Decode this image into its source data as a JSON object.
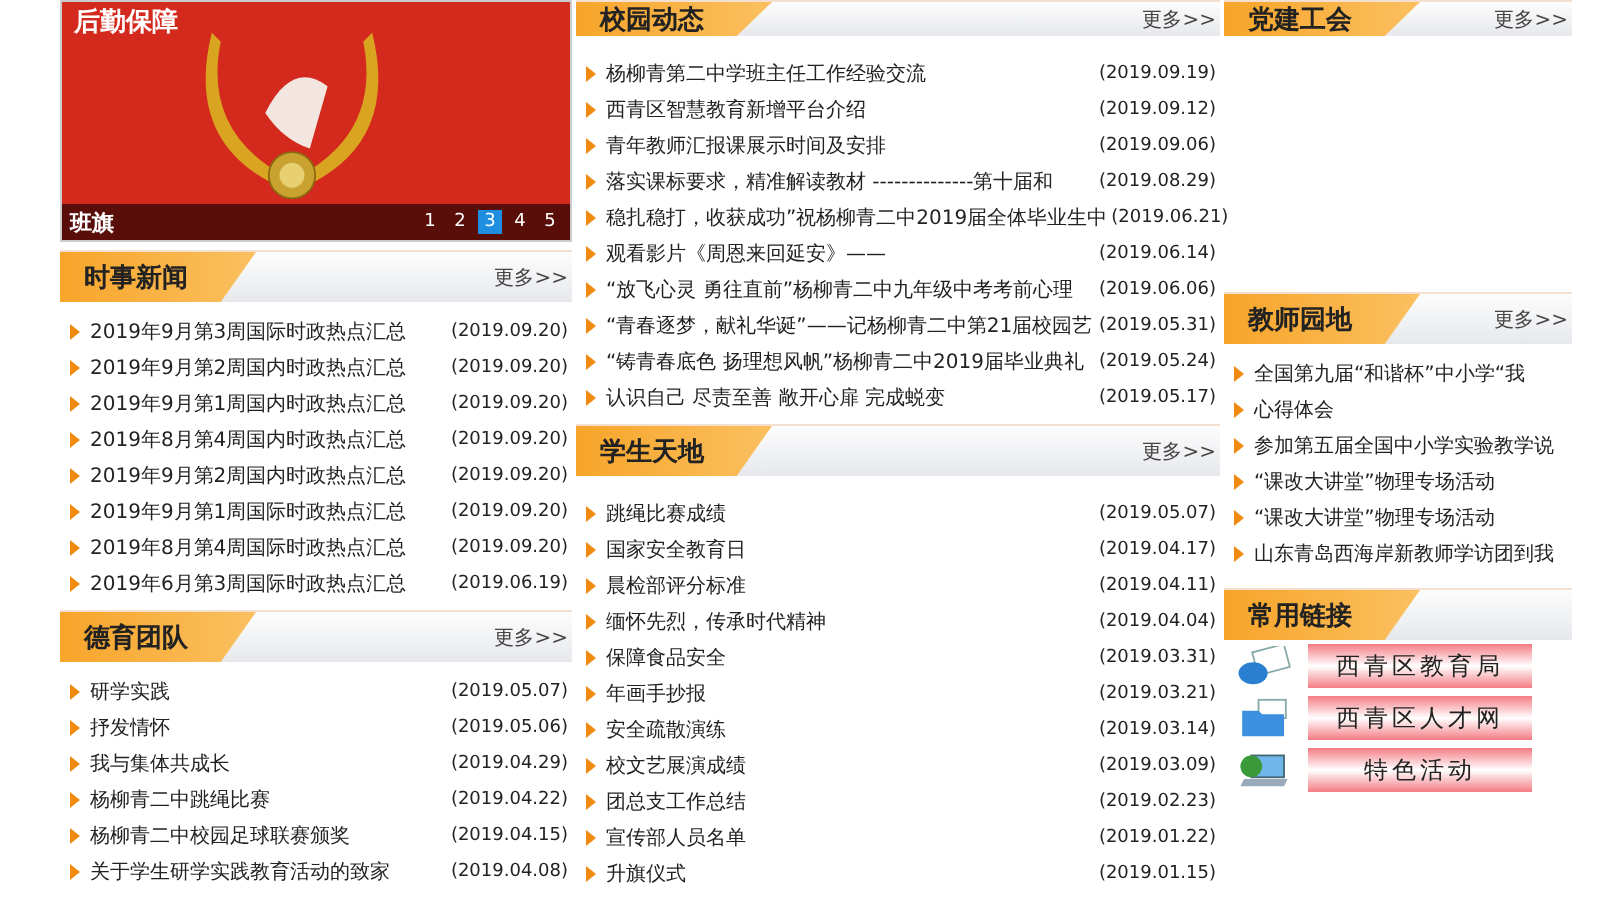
{
  "columns": [
    {
      "sections": [
        {
          "kind": "banner",
          "overlay_title": "后勤保障",
          "caption": "班旗",
          "pages": [
            {
              "label": "1",
              "selected": false
            },
            {
              "label": "2",
              "selected": false
            },
            {
              "label": "3",
              "selected": true
            },
            {
              "label": "4",
              "selected": false
            },
            {
              "label": "5",
              "selected": false
            }
          ]
        },
        {
          "kind": "list",
          "title": "时事新闻",
          "more": "更多>>",
          "items": [
            {
              "title": "2019年9月第3周国际时政热点汇总",
              "date": "(2019.09.20)"
            },
            {
              "title": "2019年9月第2周国内时政热点汇总",
              "date": "(2019.09.20)"
            },
            {
              "title": "2019年9月第1周国内时政热点汇总",
              "date": "(2019.09.20)"
            },
            {
              "title": "2019年8月第4周国内时政热点汇总",
              "date": "(2019.09.20)"
            },
            {
              "title": "2019年9月第2周国内时政热点汇总",
              "date": "(2019.09.20)"
            },
            {
              "title": "2019年9月第1周国际时政热点汇总",
              "date": "(2019.09.20)"
            },
            {
              "title": "2019年8月第4周国际时政热点汇总",
              "date": "(2019.09.20)"
            },
            {
              "title": "2019年6月第3周国际时政热点汇总",
              "date": "(2019.06.19)"
            }
          ]
        },
        {
          "kind": "list",
          "title": "德育团队",
          "more": "更多>>",
          "items": [
            {
              "title": "研学实践",
              "date": "(2019.05.07)"
            },
            {
              "title": "抒发情怀",
              "date": "(2019.05.06)"
            },
            {
              "title": "我与集体共成长",
              "date": "(2019.04.29)"
            },
            {
              "title": "杨柳青二中跳绳比赛",
              "date": "(2019.04.22)"
            },
            {
              "title": "杨柳青二中校园足球联赛颁奖",
              "date": "(2019.04.15)"
            },
            {
              "title": "关于学生研学实践教育活动的致家",
              "date": "(2019.04.08)"
            }
          ]
        }
      ]
    },
    {
      "sections": [
        {
          "kind": "list",
          "title": "校园动态",
          "more": "更多>>",
          "items": [
            {
              "title": "杨柳青第二中学班主任工作经验交流",
              "date": "(2019.09.19)"
            },
            {
              "title": "西青区智慧教育新增平台介绍",
              "date": "(2019.09.12)"
            },
            {
              "title": "青年教师汇报课展示时间及安排",
              "date": "(2019.09.06)"
            },
            {
              "title": "落实课标要求，精准解读教材 --------------第十届和",
              "date": "(2019.08.29)"
            },
            {
              "title": "稳扎稳打，收获成功”祝杨柳青二中2019届全体毕业生中",
              "date": "(2019.06.21)"
            },
            {
              "title": "观看影片《周恩来回延安》——",
              "date": "(2019.06.14)"
            },
            {
              "title": "“放飞心灵 勇往直前”杨柳青二中九年级中考考前心理",
              "date": "(2019.06.06)"
            },
            {
              "title": "“青春逐梦，献礼华诞”——记杨柳青二中第21届校园艺",
              "date": "(2019.05.31)"
            },
            {
              "title": "“铸青春底色 扬理想风帆”杨柳青二中2019届毕业典礼",
              "date": "(2019.05.24)"
            },
            {
              "title": "认识自己 尽责至善 敞开心扉 完成蜕变",
              "date": "(2019.05.17)"
            }
          ]
        },
        {
          "kind": "list",
          "title": "学生天地",
          "more": "更多>>",
          "items": [
            {
              "title": "跳绳比赛成绩",
              "date": "(2019.05.07)"
            },
            {
              "title": "国家安全教育日",
              "date": "(2019.04.17)"
            },
            {
              "title": "晨检部评分标准",
              "date": "(2019.04.11)"
            },
            {
              "title": "缅怀先烈，传承时代精神",
              "date": "(2019.04.04)"
            },
            {
              "title": "保障食品安全",
              "date": "(2019.03.31)"
            },
            {
              "title": "年画手抄报",
              "date": "(2019.03.21)"
            },
            {
              "title": "安全疏散演练",
              "date": "(2019.03.14)"
            },
            {
              "title": "校文艺展演成绩",
              "date": "(2019.03.09)"
            },
            {
              "title": "团总支工作总结",
              "date": "(2019.02.23)"
            },
            {
              "title": "宣传部人员名单",
              "date": "(2019.01.22)"
            },
            {
              "title": "升旗仪式",
              "date": "(2019.01.15)"
            }
          ]
        }
      ]
    },
    {
      "sections": [
        {
          "kind": "list",
          "title": "党建工会",
          "more": "更多>>"
        },
        {
          "kind": "list",
          "title": "教师园地",
          "more": "更多>>",
          "items": [
            {
              "title": "全国第九届“和谐杯”中小学“我"
            },
            {
              "title": "心得体会"
            },
            {
              "title": "参加第五届全国中小学实验教学说"
            },
            {
              "title": "“课改大讲堂”物理专场活动"
            },
            {
              "title": "“课改大讲堂”物理专场活动"
            },
            {
              "title": "山东青岛西海岸新教师学访团到我"
            }
          ]
        },
        {
          "kind": "links",
          "title": "常用链接",
          "links": [
            {
              "label": "西青区教育局"
            },
            {
              "label": "西青区人才网"
            },
            {
              "label": "特色活动"
            }
          ]
        }
      ]
    }
  ]
}
